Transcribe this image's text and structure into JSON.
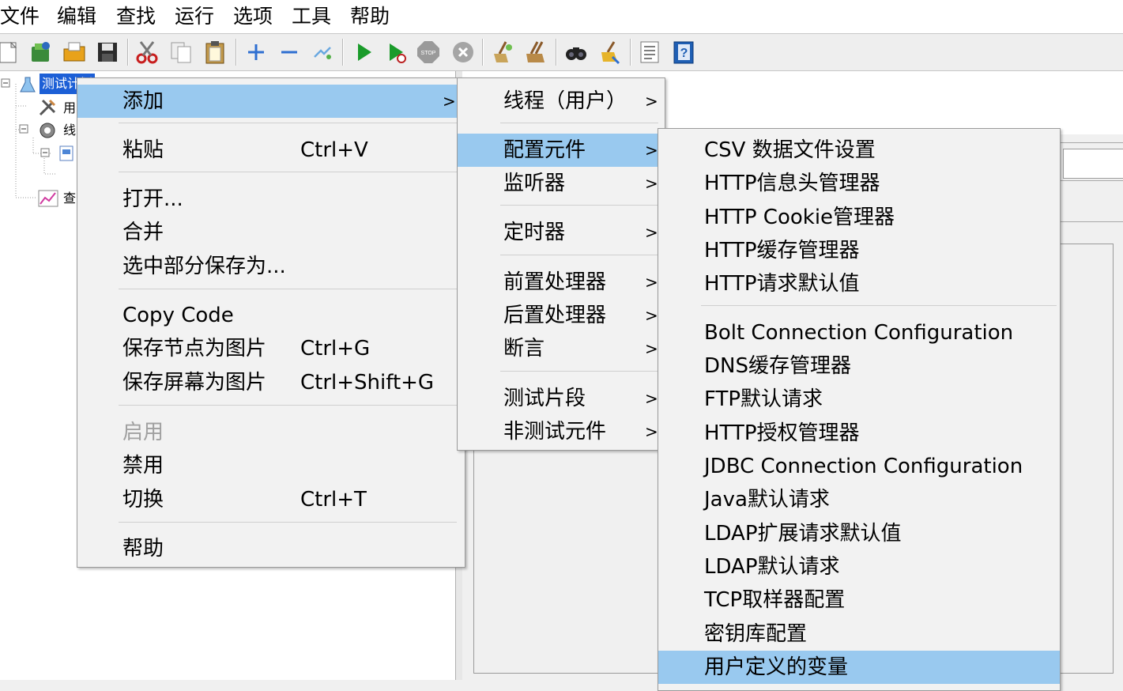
{
  "menubar": {
    "items": [
      "文件",
      "编辑",
      "查找",
      "运行",
      "选项",
      "工具",
      "帮助"
    ]
  },
  "toolbar": {
    "icons": [
      "new-icon",
      "templates-icon",
      "open-icon",
      "save-icon",
      "cut-icon",
      "copy-icon",
      "paste-icon",
      "expand-icon",
      "collapse-icon",
      "toggle-icon",
      "start-icon",
      "start-no-pause-icon",
      "stop-icon",
      "shutdown-icon",
      "clear-icon",
      "clear-all-icon",
      "search-icon",
      "reset-search-icon",
      "function-helper-icon",
      "help-icon"
    ]
  },
  "tree": {
    "items": [
      {
        "label": "测试计划",
        "selected": true
      },
      {
        "label": "用"
      },
      {
        "label": "线"
      },
      {
        "label": ""
      },
      {
        "label": "查"
      }
    ]
  },
  "context_menu": {
    "items": [
      {
        "label": "添加",
        "submenu": true,
        "highlighted": true
      },
      {
        "label": "粘贴",
        "shortcut": "Ctrl+V"
      },
      {
        "label": "打开..."
      },
      {
        "label": "合并"
      },
      {
        "label": "选中部分保存为..."
      },
      {
        "label": "Copy Code"
      },
      {
        "label": "保存节点为图片",
        "shortcut": "Ctrl+G"
      },
      {
        "label": "保存屏幕为图片",
        "shortcut": "Ctrl+Shift+G"
      },
      {
        "label": "启用",
        "disabled": true
      },
      {
        "label": "禁用"
      },
      {
        "label": "切换",
        "shortcut": "Ctrl+T"
      },
      {
        "label": "帮助"
      }
    ]
  },
  "add_submenu": {
    "items": [
      {
        "label": "线程（用户）"
      },
      {
        "label": "配置元件",
        "highlighted": true
      },
      {
        "label": "监听器"
      },
      {
        "label": "定时器"
      },
      {
        "label": "前置处理器"
      },
      {
        "label": "后置处理器"
      },
      {
        "label": "断言"
      },
      {
        "label": "测试片段"
      },
      {
        "label": "非测试元件"
      }
    ],
    "arrow": ">"
  },
  "config_submenu": {
    "items": [
      {
        "label": "CSV 数据文件设置"
      },
      {
        "label": "HTTP信息头管理器"
      },
      {
        "label": "HTTP Cookie管理器"
      },
      {
        "label": "HTTP缓存管理器"
      },
      {
        "label": "HTTP请求默认值"
      },
      {
        "label": "Bolt Connection Configuration"
      },
      {
        "label": "DNS缓存管理器"
      },
      {
        "label": "FTP默认请求"
      },
      {
        "label": "HTTP授权管理器"
      },
      {
        "label": "JDBC Connection Configuration"
      },
      {
        "label": "Java默认请求"
      },
      {
        "label": "LDAP扩展请求默认值"
      },
      {
        "label": "LDAP默认请求"
      },
      {
        "label": "TCP取样器配置"
      },
      {
        "label": "密钥库配置"
      },
      {
        "label": "用户定义的变量",
        "highlighted": true
      }
    ]
  },
  "colors": {
    "highlight": "#99c9ef",
    "selection": "#1c5fd6",
    "disabled_text": "#a0a0a0"
  }
}
